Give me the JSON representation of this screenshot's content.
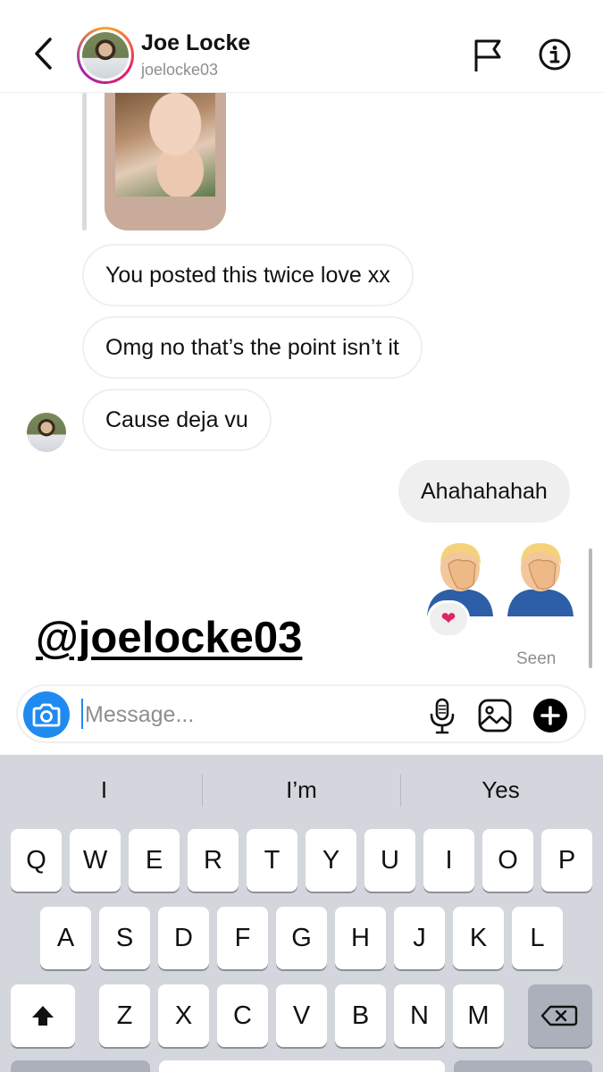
{
  "header": {
    "name": "Joe Locke",
    "handle": "joelocke03"
  },
  "messages": {
    "received": [
      "You posted this twice love xx",
      "Omg no that’s the point isn’t it",
      "Cause deja vu"
    ],
    "sent": "Ahahahahah",
    "reaction": "❤",
    "status": "Seen"
  },
  "watermark": "@joelocke03",
  "composer": {
    "placeholder": "Message..."
  },
  "keyboard": {
    "suggestions": [
      "I",
      "I’m",
      "Yes"
    ],
    "row1": [
      "Q",
      "W",
      "E",
      "R",
      "T",
      "Y",
      "U",
      "I",
      "O",
      "P"
    ],
    "row2": [
      "A",
      "S",
      "D",
      "F",
      "G",
      "H",
      "J",
      "K",
      "L"
    ],
    "row3": [
      "Z",
      "X",
      "C",
      "V",
      "B",
      "N",
      "M"
    ]
  },
  "icons": {
    "back": "chevron-left-icon",
    "flag": "flag-icon",
    "info": "info-icon",
    "camera": "camera-icon",
    "mic": "microphone-icon",
    "gallery": "gallery-icon",
    "plus": "plus-icon",
    "shift": "shift-icon",
    "delete": "backspace-icon"
  },
  "colors": {
    "accent": "#1f8bf0",
    "bubble_sent": "#efefef",
    "keyboard_bg": "#d3d6dc"
  }
}
